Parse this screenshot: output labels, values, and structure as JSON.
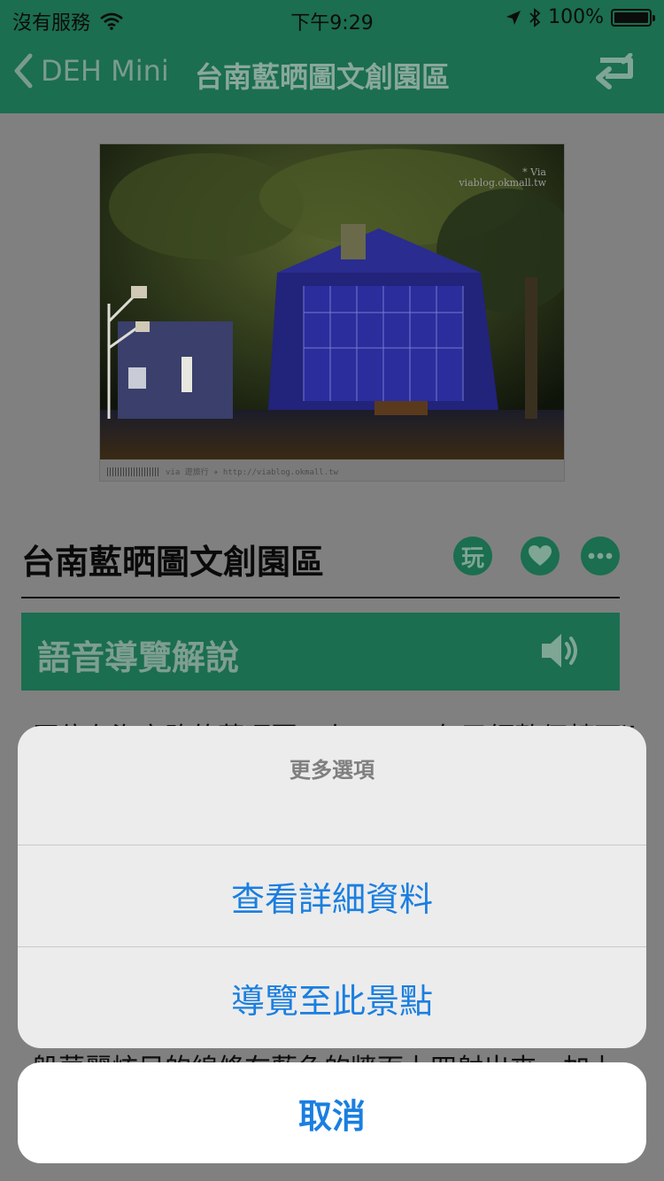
{
  "status_bar": {
    "carrier": "沒有服務",
    "time": "下午9:29",
    "battery_percent": "100%",
    "battery_level": 1.0,
    "icons": [
      "wifi-icon",
      "location-arrow-icon",
      "bluetooth-icon",
      "battery-icon"
    ]
  },
  "nav": {
    "back_label": "DEH Mini",
    "title": "台南藍晒圖文創園區",
    "action_icon": "return-icon"
  },
  "photo": {
    "watermark_line1": "* Via",
    "watermark_line2": "viablog.okmall.tw",
    "caption": "via 遊旅行 ✈ http://viablog.okmall.tw"
  },
  "place": {
    "title": "台南藍晒圖文創園區",
    "play_icon_label": "玩",
    "icons": [
      "play-badge-icon",
      "heart-icon",
      "more-icon"
    ]
  },
  "audio": {
    "label": "語音導覽解說",
    "icon": "speaker-icon"
  },
  "body_text": {
    "line_top": "原位在海安路的藍晒圖，在 2016 年已經整個轉面達",
    "line_bottom": "般華麗炫目的線條在藍色的牆面上四射出來，加上"
  },
  "action_sheet": {
    "title": "更多選項",
    "options": [
      {
        "label": "查看詳細資料"
      },
      {
        "label": "導覽至此景點"
      }
    ],
    "cancel_label": "取消"
  },
  "colors": {
    "theme_green": "#1b6e4f",
    "dim_overlay": "#808080",
    "action_blue": "#1a7fe0",
    "sheet_bg": "#ececec"
  }
}
